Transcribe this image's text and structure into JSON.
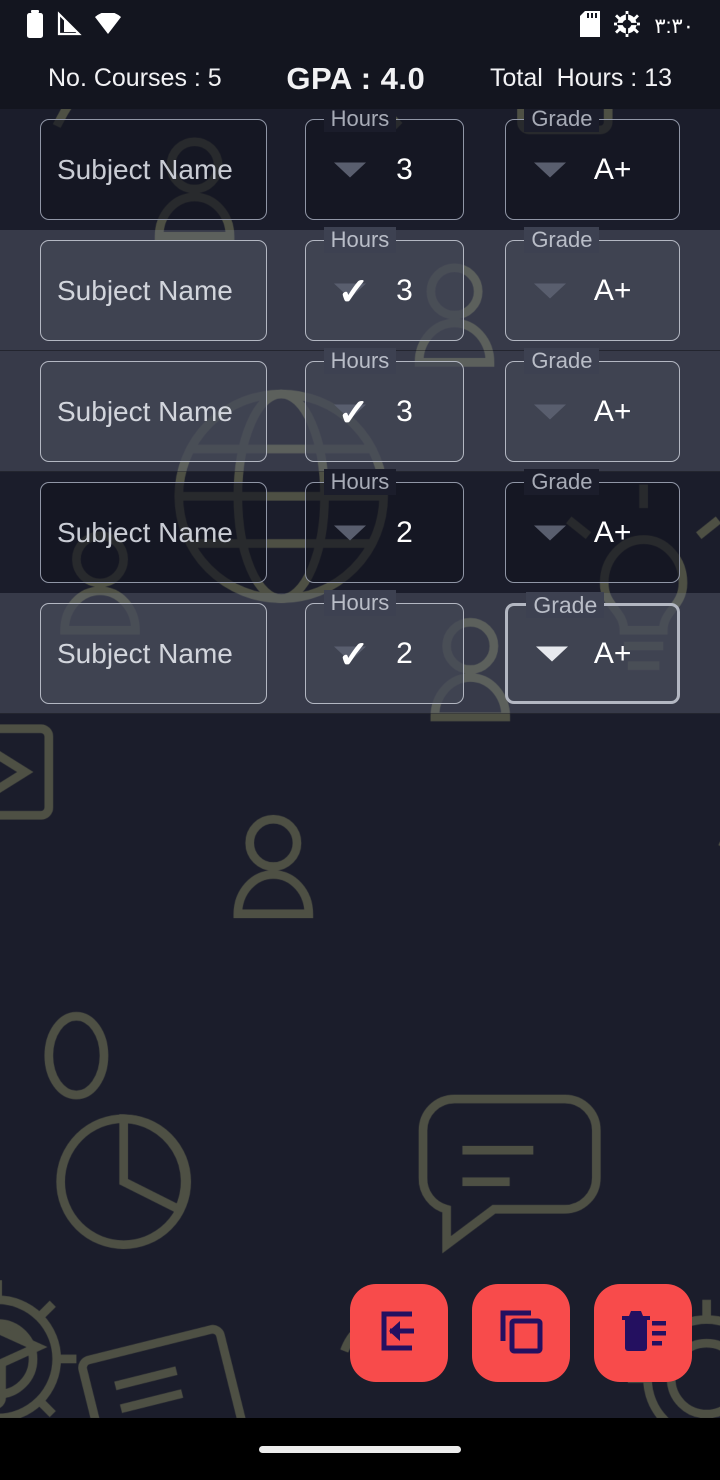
{
  "status_bar": {
    "icons_left": [
      "battery-icon",
      "signal-icon",
      "wifi-icon"
    ],
    "icons_right": [
      "sd-card-icon",
      "gear-icon"
    ],
    "time": "٣:٣٠"
  },
  "summary": {
    "courses": "No. Courses : 5",
    "gpa": "GPA : 4.0",
    "total_hours": "Total  Hours : 13"
  },
  "labels": {
    "hours": "Hours",
    "grade": "Grade",
    "subject_placeholder": "Subject Name"
  },
  "rows": [
    {
      "subject": "Subject Name",
      "hours": "3",
      "grade": "A+",
      "selected": false,
      "checked": false,
      "grade_focused": false
    },
    {
      "subject": "Subject Name",
      "hours": "3",
      "grade": "A+",
      "selected": true,
      "checked": true,
      "grade_focused": false
    },
    {
      "subject": "Subject Name",
      "hours": "3",
      "grade": "A+",
      "selected": true,
      "checked": true,
      "grade_focused": false
    },
    {
      "subject": "Subject Name",
      "hours": "2",
      "grade": "A+",
      "selected": false,
      "checked": false,
      "grade_focused": false
    },
    {
      "subject": "Subject Name",
      "hours": "2",
      "grade": "A+",
      "selected": true,
      "checked": true,
      "grade_focused": true
    }
  ],
  "actions": [
    {
      "name": "save-exit-button",
      "icon": "exit-arrow-icon"
    },
    {
      "name": "duplicate-button",
      "icon": "copy-icon"
    },
    {
      "name": "delete-all-button",
      "icon": "delete-sweep-icon"
    }
  ],
  "colors": {
    "accent": "#F84B4B",
    "icon_on_accent": "#241060",
    "background": "#1B1D2B",
    "bar_background": "#13151F",
    "field_border": "#9096A6",
    "focus_border": "#FFFFFF",
    "selected_row_overlay": "#868EA3"
  },
  "nav_bar": {
    "gesture_pill": "home-indicator"
  }
}
